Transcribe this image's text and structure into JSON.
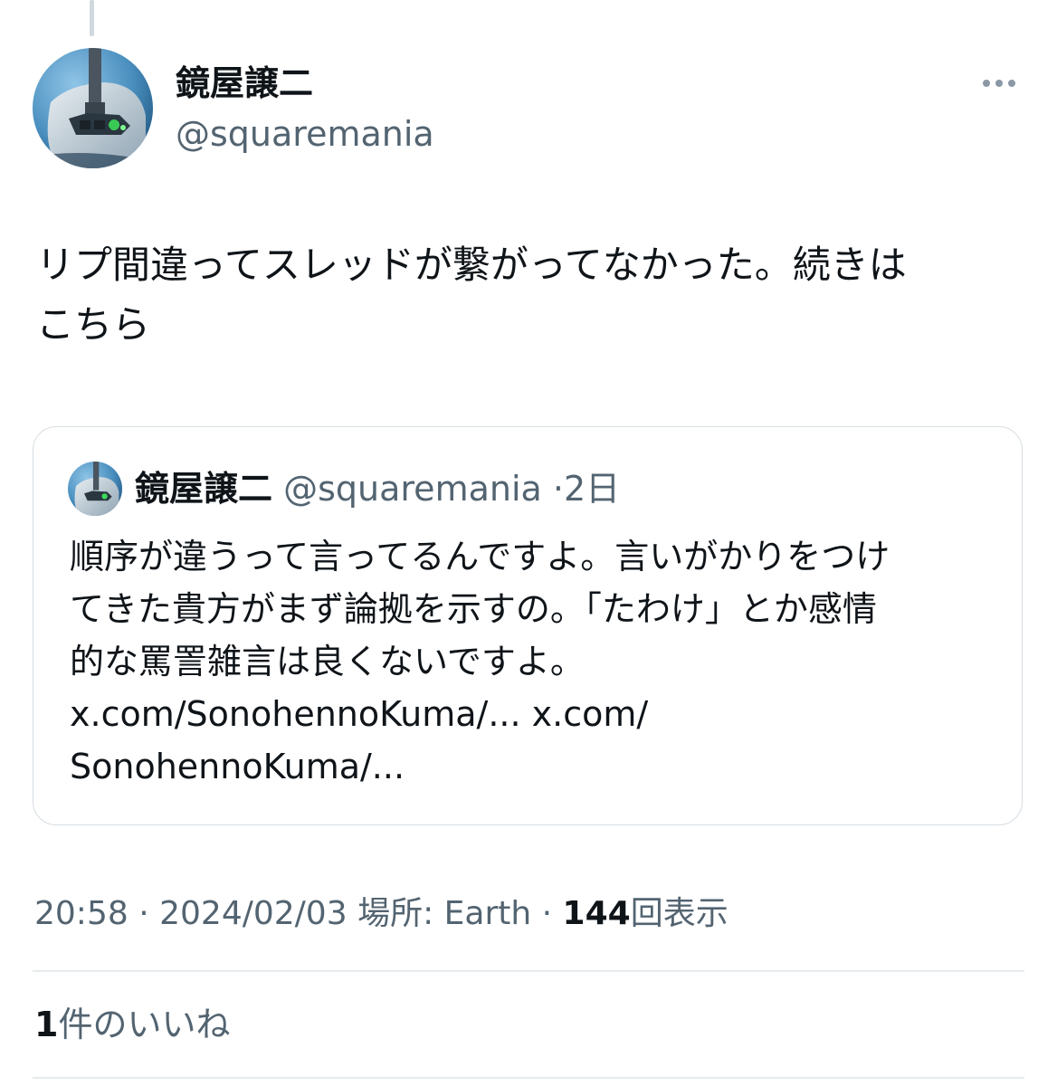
{
  "author": {
    "display_name": "鏡屋譲二",
    "handle": "@squaremania",
    "avatar_icon": "aircraft-cockpit-avatar"
  },
  "more_icon": "more-horizontal-icon",
  "tweet": {
    "text": "リプ間違ってスレッドが繋がってなかった。続きは\nこちら"
  },
  "quoted": {
    "display_name": "鏡屋譲二",
    "handle": "@squaremania",
    "separator": "·",
    "time": "2日",
    "text": "順序が違うって言ってるんですよ。言いがかりをつけ\nてきた貴方がまず論拠を示すの。「たわけ」とか感情\n的な罵詈雑言は良くないですよ。\nx.com/SonohennoKuma/... x.com/\nSonohennoKuma/..."
  },
  "meta": {
    "time": "20:58",
    "sep1": "·",
    "date": "2024/02/03",
    "location": "場所: Earth",
    "sep2": "·",
    "views_count": "144",
    "views_label": "回表示"
  },
  "engagement": {
    "likes_count": "1",
    "likes_label": "件のいいね"
  },
  "colors": {
    "text_primary": "#0f1419",
    "text_secondary": "#536471",
    "border": "#d7dde2"
  }
}
